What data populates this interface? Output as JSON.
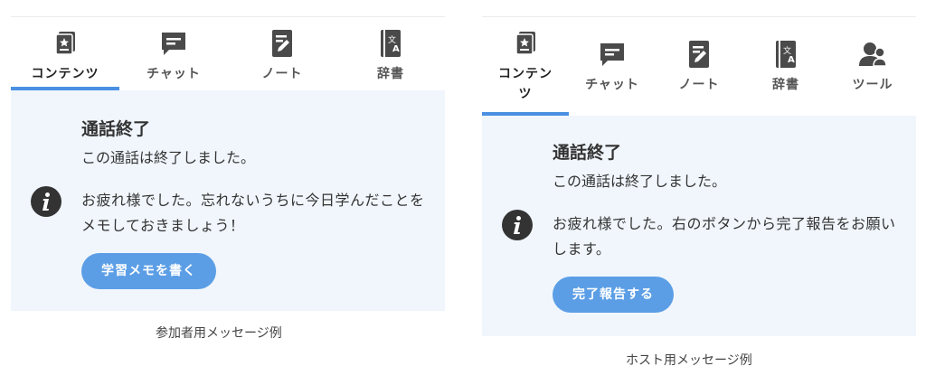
{
  "colors": {
    "accent": "#4a90e2",
    "button": "#5b9ee6",
    "panel_bg": "#f0f6fc",
    "icon": "#4a4a4a"
  },
  "participant": {
    "tabs": [
      {
        "label": "コンテンツ",
        "icon": "content-book-icon"
      },
      {
        "label": "チャット",
        "icon": "chat-bubble-icon"
      },
      {
        "label": "ノート",
        "icon": "note-pen-icon"
      },
      {
        "label": "辞書",
        "icon": "dictionary-icon"
      }
    ],
    "active_tab": "コンテンツ",
    "message": {
      "title": "通話終了",
      "line1": "この通話は終了しました。",
      "detail": "お疲れ様でした。忘れないうちに今日学んだことをメモしておきましょう！",
      "button": "学習メモを書く"
    },
    "caption": "参加者用メッセージ例"
  },
  "host": {
    "tabs": [
      {
        "label": "コンテンツ",
        "icon": "content-book-icon"
      },
      {
        "label": "チャット",
        "icon": "chat-bubble-icon"
      },
      {
        "label": "ノート",
        "icon": "note-pen-icon"
      },
      {
        "label": "辞書",
        "icon": "dictionary-icon"
      },
      {
        "label": "ツール",
        "icon": "users-tool-icon"
      }
    ],
    "active_tab": "コンテンツ",
    "message": {
      "title": "通話終了",
      "line1": "この通話は終了しました。",
      "detail": "お疲れ様でした。右のボタンから完了報告をお願いします。",
      "button": "完了報告する"
    },
    "caption": "ホスト用メッセージ例"
  }
}
